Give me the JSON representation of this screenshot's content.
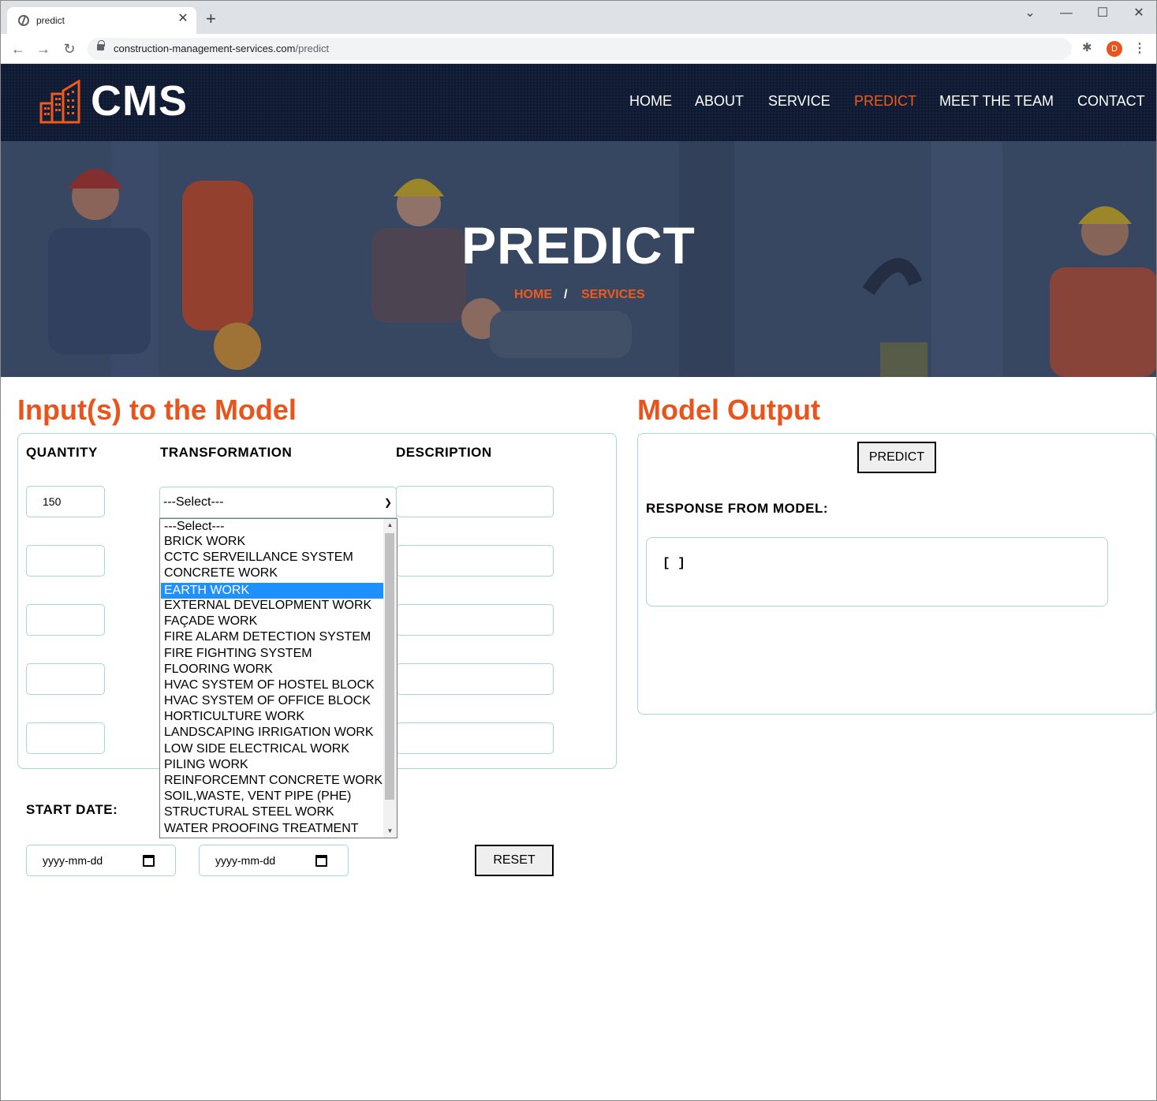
{
  "browser": {
    "tab_title": "predict",
    "url_domain": "construction-management-services.com",
    "url_path": "/predict",
    "profile_initial": "D"
  },
  "header": {
    "logo_text": "CMS",
    "nav": [
      "HOME",
      "ABOUT",
      "SERVICE",
      "PREDICT",
      "MEET THE TEAM",
      "CONTACT"
    ],
    "active_nav": "PREDICT",
    "accent_color": "#f05a1a"
  },
  "hero": {
    "title": "PREDICT",
    "breadcrumb_home": "HOME",
    "breadcrumb_sep": "/",
    "breadcrumb_current": "SERVICES"
  },
  "inputs": {
    "title": "Input(s) to the Model",
    "col_quantity": "QUANTITY",
    "col_transformation": "TRANSFORMATION",
    "col_description": "DESCRIPTION",
    "quantities": [
      "150",
      "",
      "",
      "",
      ""
    ],
    "descriptions": [
      "",
      "",
      "",
      "",
      ""
    ],
    "select_value": "---Select---",
    "options": [
      "---Select---",
      "BRICK WORK",
      "CCTC SERVEILLANCE SYSTEM",
      "CONCRETE WORK",
      "EARTH WORK",
      "EXTERNAL DEVELOPMENT WORK",
      "FAÇADE WORK",
      "FIRE ALARM DETECTION SYSTEM",
      "FIRE FIGHTING SYSTEM",
      "FLOORING WORK",
      "HVAC SYSTEM OF HOSTEL BLOCK",
      "HVAC SYSTEM OF OFFICE BLOCK",
      "HORTICULTURE WORK",
      "LANDSCAPING IRRIGATION WORK",
      "LOW SIDE ELECTRICAL WORK",
      "PILING WORK",
      "REINFORCEMNT CONCRETE WORK",
      "SOIL,WASTE, VENT PIPE (PHE)",
      "STRUCTURAL STEEL WORK",
      "WATER PROOFING TREATMENT"
    ],
    "highlighted_option": "EARTH WORK",
    "start_date_label": "START DATE:",
    "start_date_placeholder": "yyyy-mm-dd",
    "end_date_placeholder": "yyyy-mm-dd",
    "reset_label": "RESET"
  },
  "output": {
    "title": "Model Output",
    "predict_label": "PREDICT",
    "response_label": "RESPONSE FROM MODEL:",
    "response_value": "[ ]"
  }
}
